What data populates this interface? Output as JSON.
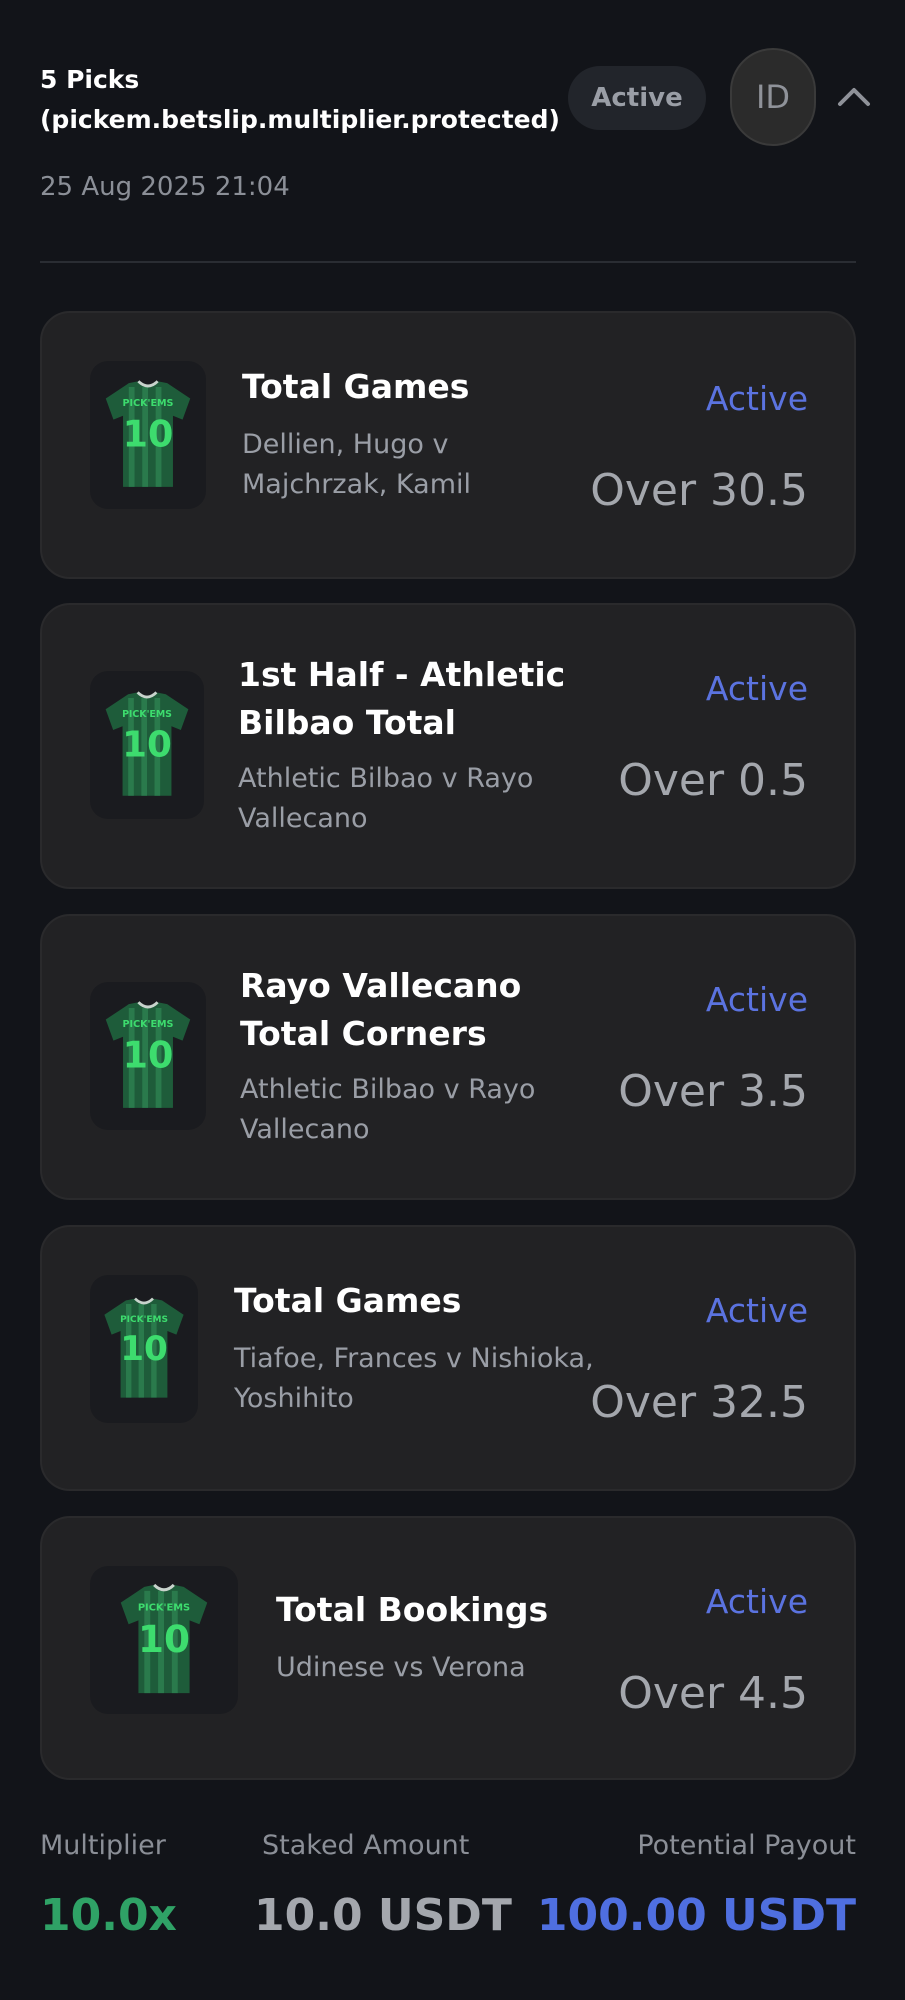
{
  "header": {
    "title": "5 Picks (pickem.betslip.multiplier.protected)",
    "date": "25 Aug 2025 21:04",
    "status": "Active",
    "avatar_initials": "ID"
  },
  "jersey": {
    "brand": "PICK'EMS",
    "number": "10"
  },
  "picks": [
    {
      "title": "Total Games",
      "subtitle": "Dellien, Hugo v Majchrzak, Kamil",
      "status": "Active",
      "line": "Over 30.5"
    },
    {
      "title": "1st Half - Athletic Bilbao Total",
      "subtitle": "Athletic Bilbao v Rayo Vallecano",
      "status": "Active",
      "line": "Over 0.5"
    },
    {
      "title": "Rayo Vallecano Total Corners",
      "subtitle": "Athletic Bilbao v Rayo Vallecano",
      "status": "Active",
      "line": "Over 3.5"
    },
    {
      "title": "Total Games",
      "subtitle": "Tiafoe, Frances v Nishioka, Yoshihito",
      "status": "Active",
      "line": "Over 32.5"
    },
    {
      "title": "Total Bookings",
      "subtitle": "Udinese vs Verona",
      "status": "Active",
      "line": "Over 4.5"
    }
  ],
  "footer": {
    "multiplier_label": "Multiplier",
    "multiplier_value": "10.0x",
    "staked_label": "Staked Amount",
    "staked_value": "10.0 USDT",
    "payout_label": "Potential Payout",
    "payout_value": "100.00 USDT"
  },
  "colors": {
    "background": "#121419",
    "card": "#222224",
    "active_blue": "#5b73e0",
    "multiplier_green": "#2fa266",
    "payout_blue": "#4f6fe0",
    "staked_gray": "#a4a7ad"
  }
}
